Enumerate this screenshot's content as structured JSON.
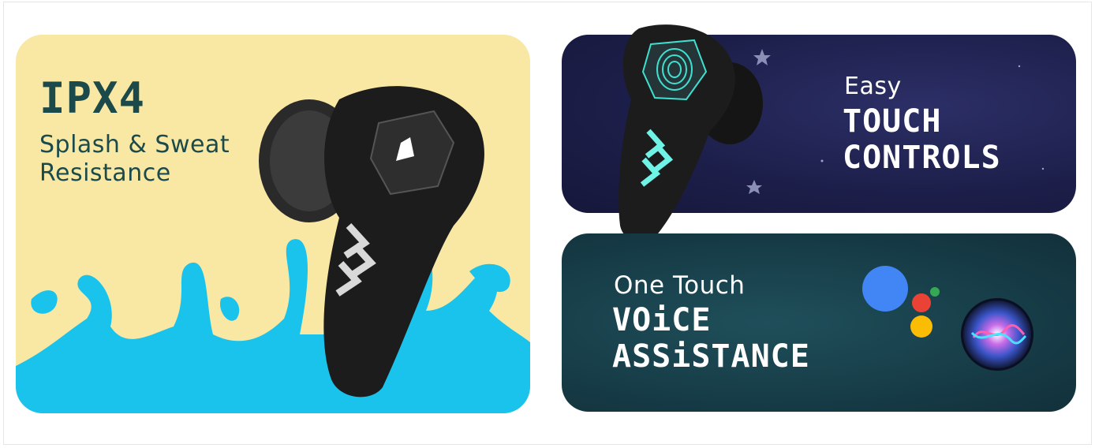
{
  "cards": {
    "water": {
      "title": "IPX4",
      "subtitle_line1": "Splash & Sweat",
      "subtitle_line2": "Resistance",
      "background": "#f8e8a4",
      "text_color": "#1c4a4a",
      "splash_color": "#19c3ec"
    },
    "touch": {
      "small_label": "Easy",
      "big_line1": "TOUCH",
      "big_line2": "CONTROLS",
      "background": "#1d1f4b"
    },
    "voice": {
      "small_label": "One Touch",
      "big_line1": "VOiCE",
      "big_line2": "ASSiSTANCE",
      "background": "#173e49"
    }
  },
  "icons": {
    "earbud": "earbud-icon",
    "brand_logo": "brand-logo-icon",
    "chevrons": "chevrons-icon",
    "fingerprint": "fingerprint-icon",
    "google_assistant": "google-assistant-icon",
    "siri": "siri-icon",
    "stars": "star-icon"
  },
  "colors": {
    "assistant_blue": "#4285f4",
    "assistant_red": "#ea4335",
    "assistant_yellow": "#fbbc05",
    "assistant_green": "#34a853",
    "accent_cyan": "#3fe0d0"
  }
}
